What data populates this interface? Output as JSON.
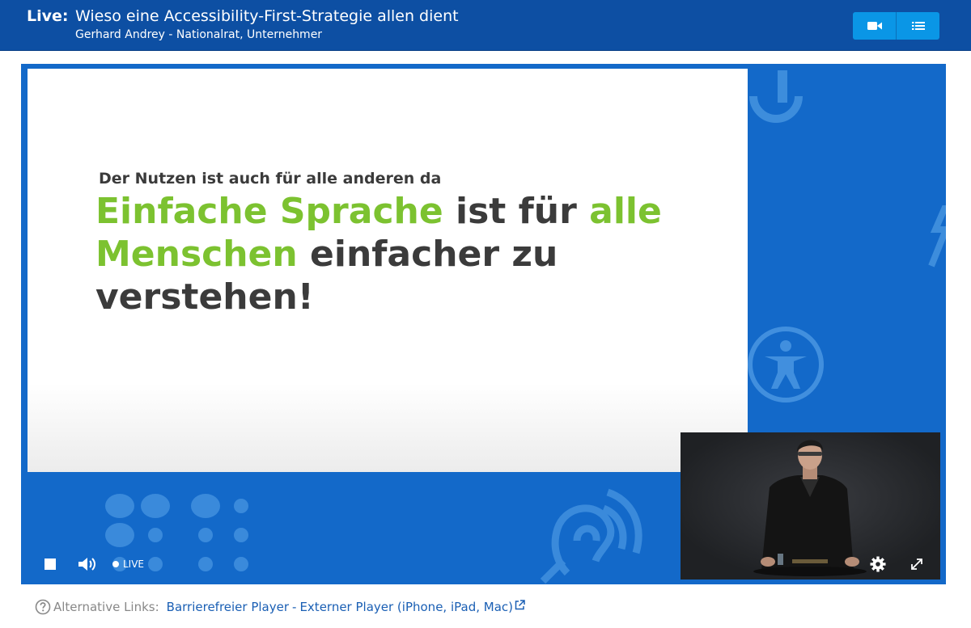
{
  "header": {
    "live_label": "Live:",
    "title": "Wieso eine Accessibility-First-Strategie allen dient",
    "subtitle": "Gerhard Andrey - Nationalrat, Unternehmer",
    "buttons": [
      {
        "icon": "video-camera-icon"
      },
      {
        "icon": "list-icon"
      }
    ]
  },
  "slide": {
    "subheading": "Der Nutzen ist auch für alle anderen da",
    "headline_parts": [
      {
        "text": "Einfache Sprache",
        "color": "#7cc230"
      },
      {
        "text": " ist für ",
        "color": "#3b3b3b"
      },
      {
        "text": "alle Menschen",
        "color": "#7cc230"
      },
      {
        "text": " einfacher zu verstehen!",
        "color": "#3b3b3b"
      }
    ]
  },
  "player": {
    "live_text": "LIVE",
    "controls": [
      "stop-icon",
      "volume-icon",
      "settings-icon",
      "fullscreen-icon"
    ]
  },
  "footer": {
    "alt_label": "Alternative Links:",
    "link1": "Barrierefreier Player",
    "separator": "-",
    "link2": "Externer Player (iPhone, iPad, Mac)"
  },
  "colors": {
    "header_bg": "#0d4fa3",
    "header_button": "#0a96e6",
    "player_bg": "#1369c9",
    "accent_green": "#7cc230",
    "text_dark": "#3b3b3b",
    "link": "#1a5fb4"
  }
}
